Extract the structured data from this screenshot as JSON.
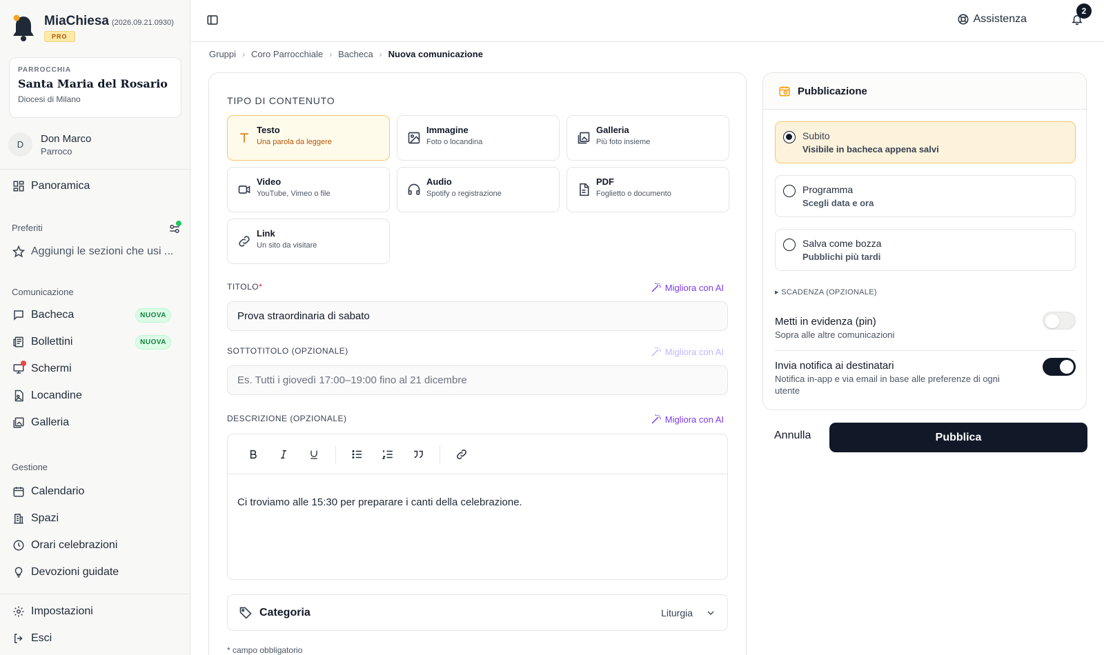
{
  "app": {
    "name": "MiaChiesa",
    "version": "(2026.09.21.0930)",
    "plan": "PRO"
  },
  "parish": {
    "kicker": "PARROCCHIA",
    "name": "Santa Maria del Rosario",
    "diocese": "Diocesi di Milano"
  },
  "user": {
    "initial": "D",
    "name": "Don Marco",
    "role": "Parroco"
  },
  "sidebar": {
    "overview": "Panoramica",
    "favorites_title": "Preferiti",
    "favorites_hint": "Aggiungi le sezioni che usi ...",
    "communication_title": "Comunicazione",
    "communication": [
      {
        "label": "Bacheca",
        "badge": "NUOVA",
        "icon": "message-icon"
      },
      {
        "label": "Bollettini",
        "badge": "NUOVA",
        "icon": "newspaper-icon"
      },
      {
        "label": "Schermi",
        "badge": "",
        "icon": "screen-icon",
        "dot": true
      },
      {
        "label": "Locandine",
        "badge": "",
        "icon": "poster-icon"
      },
      {
        "label": "Galleria",
        "badge": "",
        "icon": "gallery-icon"
      }
    ],
    "management_title": "Gestione",
    "management": [
      {
        "label": "Calendario",
        "icon": "calendar-icon"
      },
      {
        "label": "Spazi",
        "icon": "building-icon"
      },
      {
        "label": "Orari celebrazioni",
        "icon": "clock-icon"
      },
      {
        "label": "Devozioni guidate",
        "icon": "lightbulb-icon"
      }
    ],
    "settings": "Impostazioni",
    "logout": "Esci"
  },
  "topbar": {
    "help": "Assistenza",
    "notifications": "2"
  },
  "breadcrumb": [
    "Gruppi",
    "Coro Parrocchiale",
    "Bacheca",
    "Nuova comunicazione"
  ],
  "form": {
    "content_type_label": "TIPO DI CONTENUTO",
    "types": [
      {
        "title": "Testo",
        "sub": "Una parola da leggere",
        "icon": "text-icon",
        "selected": true
      },
      {
        "title": "Immagine",
        "sub": "Foto o locandina",
        "icon": "image-icon"
      },
      {
        "title": "Galleria",
        "sub": "Più foto insieme",
        "icon": "gallery-icon"
      },
      {
        "title": "Video",
        "sub": "YouTube, Vimeo o file",
        "icon": "video-icon"
      },
      {
        "title": "Audio",
        "sub": "Spotify o registrazione",
        "icon": "headphones-icon"
      },
      {
        "title": "PDF",
        "sub": "Foglietto o documento",
        "icon": "document-icon"
      },
      {
        "title": "Link",
        "sub": "Un sito da visitare",
        "icon": "link-icon"
      }
    ],
    "title_label": "TITOLO",
    "required_mark": "*",
    "ai_label": "Migliora con AI",
    "title_value": "Prova straordinaria di sabato",
    "subtitle_label": "SOTTOTITOLO (OPZIONALE)",
    "subtitle_placeholder": "Es. Tutti i giovedì 17:00–19:00 fino al 21 dicembre",
    "description_label": "DESCRIZIONE (OPZIONALE)",
    "description_value": "Ci troviamo alle 15:30 per preparare i canti della celebrazione.",
    "category_label": "Categoria",
    "category_value": "Liturgia",
    "required_note": "* campo obbligatorio"
  },
  "publish": {
    "title": "Pubblicazione",
    "options": [
      {
        "title": "Subito",
        "sub": "Visibile in bacheca appena salvi",
        "selected": true
      },
      {
        "title": "Programma",
        "sub": "Scegli data e ora",
        "selected": false
      },
      {
        "title": "Salva come bozza",
        "sub": "Pubblichi più tardi",
        "selected": false
      }
    ],
    "expiry": "SCADENZA (OPZIONALE)",
    "pin_title": "Metti in evidenza (pin)",
    "pin_sub": "Sopra alle altre comunicazioni",
    "pin_on": false,
    "notify_title": "Invia notifica ai destinatari",
    "notify_sub": "Notifica in-app e via email in base alle preferenze di ogni utente",
    "notify_on": true,
    "cancel": "Annulla",
    "submit": "Pubblica"
  },
  "colors": {
    "accent": "#111827",
    "selected_bg": "#fffbeb",
    "selected_border": "#f6c66a",
    "ai": "#7c3aed",
    "badge_green": "#15803d"
  }
}
